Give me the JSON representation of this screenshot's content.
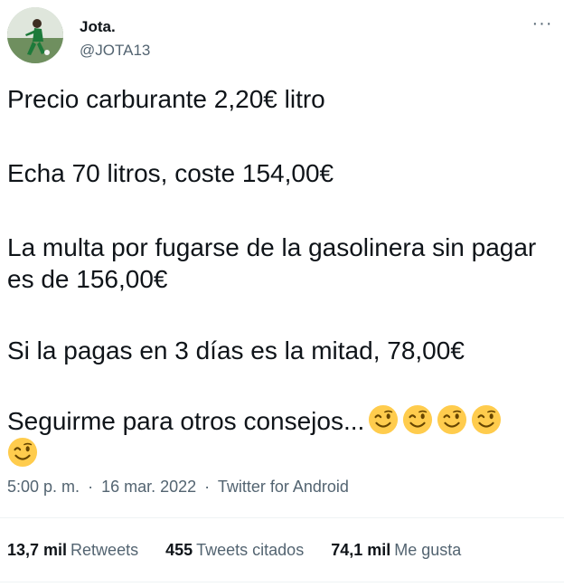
{
  "author": {
    "display_name": "Jota.",
    "handle": "@JOTA13"
  },
  "header": {
    "more_icon": "more-horizontal-icon"
  },
  "tweet": {
    "lines": [
      "Precio carburante 2,20€ litro",
      "Echa 70 litros, coste 154,00€",
      "La multa por fugarse de la gasolinera sin pagar es de 156,00€",
      "Si la pagas en 3 días es la mitad, 78,00€",
      "Seguirme para otros consejos..."
    ],
    "emoji": "winking-face-icon"
  },
  "meta": {
    "time": "5:00 p. m.",
    "separator": "·",
    "date": "16 mar. 2022",
    "source": "Twitter for Android"
  },
  "stats": {
    "retweets_count": "13,7 mil",
    "retweets_label": "Retweets",
    "quotes_count": "455",
    "quotes_label": "Tweets citados",
    "likes_count": "74,1 mil",
    "likes_label": "Me gusta"
  }
}
